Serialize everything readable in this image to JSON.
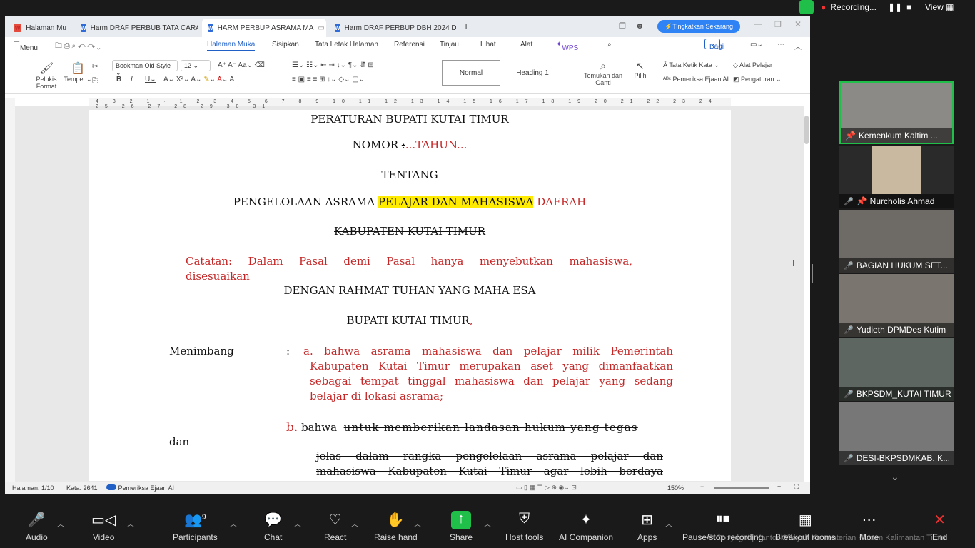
{
  "recording": {
    "label": "Recording...",
    "view": "View"
  },
  "tabs": [
    {
      "title": "Halaman Mu",
      "icon": "R"
    },
    {
      "title": "Harm DRAF PERBUB TATA CARA PEMB",
      "icon": "W"
    },
    {
      "title": "HARM PERBUP ASRAMA MA",
      "icon": "W"
    },
    {
      "title": "Harm DRAF PERBUP DBH 2024 DPMD",
      "icon": "W"
    }
  ],
  "upgrade_label": "Tingkatkan Sekarang",
  "menu_label": "Menu",
  "ribbon_tabs": [
    "Halaman Muka",
    "Sisipkan",
    "Tata Letak Halaman",
    "Referensi",
    "Tinjau",
    "Lihat",
    "Alat",
    "WPS AI"
  ],
  "share_label": "Bagi",
  "toolbar": {
    "pelukis": "Pelukis Format",
    "tempel": "Tempel",
    "font": "Bookman Old Style",
    "size": "12",
    "style_normal": "Normal",
    "style_heading": "Heading 1",
    "temukan": "Temukan dan Ganti",
    "pilih": "Pilih",
    "tata_ketik": "Tata Ketik Kata",
    "pemeriksa": "Pemeriksa Ejaan AI",
    "alat_pelajar": "Alat Pelajar",
    "pengaturan": "Pengaturan"
  },
  "doc": {
    "title": "PERATURAN BUPATI KUTAI TIMUR",
    "nomor": "NOMOR",
    "nomor_rest": "...TAHUN...",
    "tentang": "TENTANG",
    "judul_a": "PENGELOLAAN ASRAMA ",
    "judul_hl": "PELAJAR DAN MAHASISWA",
    "judul_b": " DAERAH",
    "kab": "KABUPATEN KUTAI TIMUR",
    "catatan1": "Catatan: Dalam Pasal demi Pasal hanya menyebutkan mahasiswa,",
    "catatan2": "disesuaikan",
    "rahmat": "DENGAN RAHMAT TUHAN YANG MAHA ESA",
    "bupati": "BUPATI KUTAI TIMUR",
    "menimbang": "Menimbang",
    "a1": "a.  bahwa asrama mahasiswa dan pelajar milik Pemerintah",
    "a2": "Kabupaten Kutai Timur merupakan aset yang dimanfaatkan",
    "a3": "sebagai tempat tinggal mahasiswa dan pelajar yang sedang",
    "a4": "belajar di lokasi asrama;",
    "b_lbl": "b.",
    "b_word": "bahwa",
    "b_strike": "untuk memberikan landasan hukum yang tegas",
    "b_dan": "dan",
    "b2": "jelas dalam rangka pengelolaan asrama pelajar dan",
    "b3": "mahasiswa Kabupaten Kutai Timur agar lebih berdaya"
  },
  "status": {
    "page": "Halaman: 1/10",
    "words": "Kata: 2641",
    "checker": "Pemeriksa Ejaan AI",
    "zoom": "150%"
  },
  "participants": [
    {
      "name": "Kemenkum Kaltim ...",
      "muted": false
    },
    {
      "name": "Nurcholis Ahmad",
      "muted": true
    },
    {
      "name": "BAGIAN HUKUM SET...",
      "muted": true
    },
    {
      "name": "Yudieth DPMDes Kutim",
      "muted": true
    },
    {
      "name": "BKPSDM_KUTAI TIMUR",
      "muted": true
    },
    {
      "name": "DESI-BKPSDMKAB. K...",
      "muted": true
    }
  ],
  "zoom_bar": {
    "audio": "Audio",
    "video": "Video",
    "participants": "Participants",
    "participants_count": "9",
    "chat": "Chat",
    "react": "React",
    "raise": "Raise hand",
    "share": "Share",
    "host": "Host tools",
    "ai": "AI Companion",
    "apps": "Apps",
    "pause": "Pause/stop recording",
    "breakout": "Breakout rooms",
    "more": "More",
    "end": "End",
    "copyright": "© Copyright | Kantor Wilayah Kementerian Hukum Kalimantan Timur"
  },
  "colors": {
    "accent": "#1f5fc6",
    "red_text": "#c62828",
    "highlight": "#ffeb00",
    "share_green": "#1fbf4a"
  }
}
